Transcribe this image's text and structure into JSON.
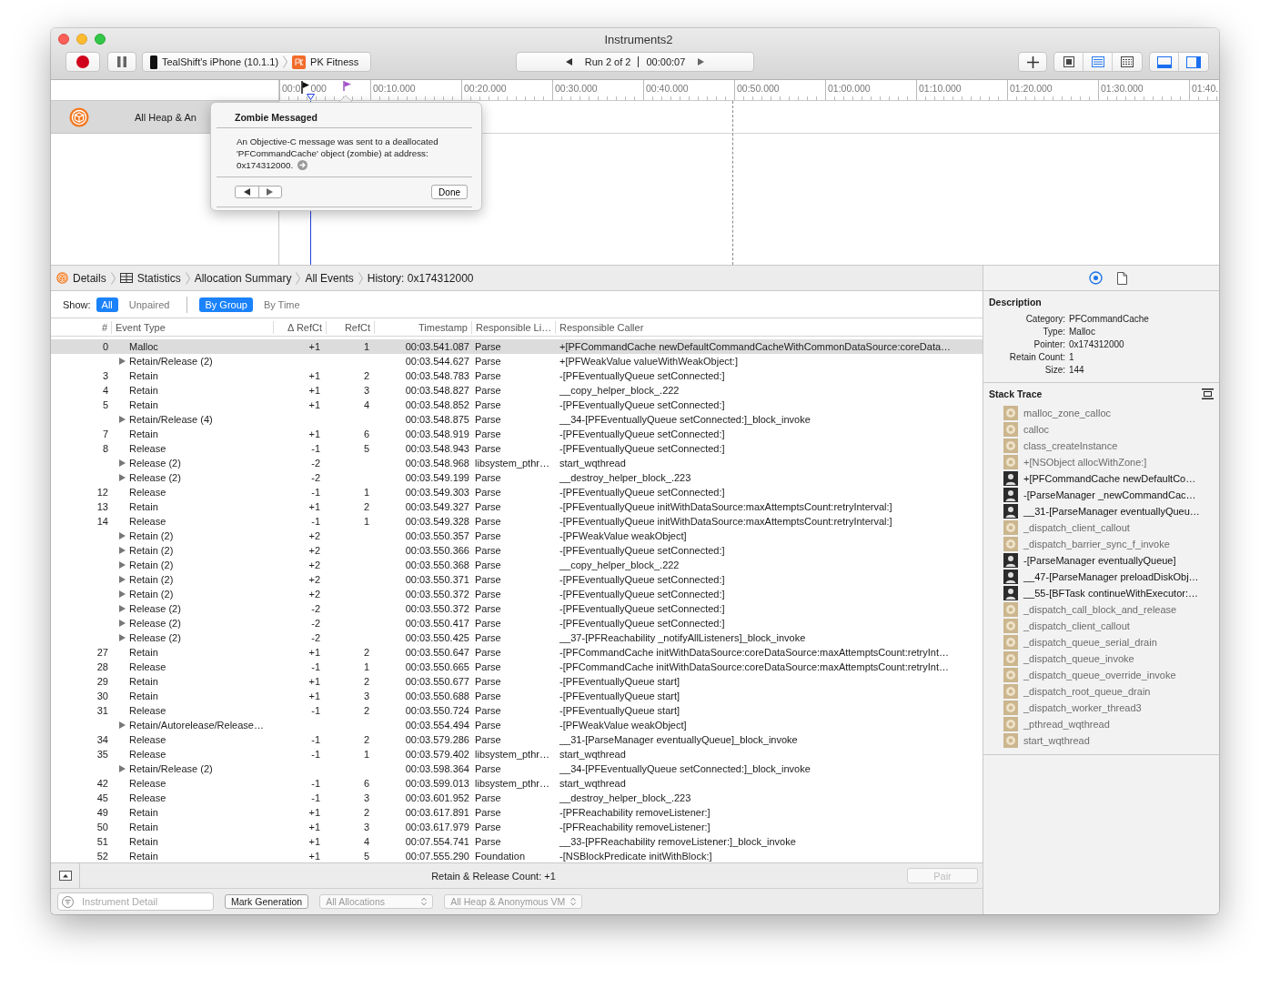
{
  "window": {
    "title": "Instruments2"
  },
  "toolbar": {
    "device": "TealShift's iPhone (10.1.1)",
    "app": "PK Fitness",
    "run": "Run 2 of 2",
    "time": "00:00:07",
    "view_buttons": [
      {
        "selected": false
      },
      {
        "selected": true
      },
      {
        "selected": false
      }
    ],
    "panels": [
      {
        "on": true
      },
      {
        "on": true
      }
    ]
  },
  "timeline": {
    "first_tick_rest": "000",
    "ticks": [
      "00:0",
      "00:10.000",
      "00:20.000",
      "00:30.000",
      "00:40.000",
      "00:50.000",
      "01:00.000",
      "01:10.000",
      "01:20.000",
      "01:30.000",
      "01:40."
    ],
    "track_label": "All Heap & An"
  },
  "popover": {
    "title": "Zombie Messaged",
    "message": "An Objective-C message was sent to a deallocated 'PFCommandCache' object (zombie) at address:",
    "address": "0x174312000.",
    "done_label": "Done"
  },
  "breadcrumbs": [
    "Details",
    "Statistics",
    "Allocation Summary",
    "All Events",
    "History: 0x174312000"
  ],
  "show_filter": {
    "label": "Show:",
    "options": [
      {
        "label": "All",
        "selected": true
      },
      {
        "label": "Unpaired",
        "selected": false
      }
    ],
    "grouping": [
      {
        "label": "By Group",
        "selected": true
      },
      {
        "label": "By Time",
        "selected": false
      }
    ]
  },
  "table": {
    "columns": [
      "#",
      "Event Type",
      "Δ RefCt",
      "RefCt",
      "Timestamp",
      "Responsible Li…",
      "Responsible Caller"
    ],
    "rows": [
      {
        "kind": "event",
        "selected": true,
        "number": "0",
        "event_type": "Malloc",
        "delta": "+1",
        "refct": "1",
        "timestamp": "00:03.541.087",
        "library": "Parse",
        "caller": "+[PFCommandCache newDefaultCommandCacheWithCommonDataSource:coreData…"
      },
      {
        "kind": "group",
        "selected": false,
        "event_type": "Retain/Release (2)",
        "timestamp": "00:03.544.627",
        "library": "Parse",
        "caller": "+[PFWeakValue valueWithWeakObject:]"
      },
      {
        "kind": "event",
        "selected": false,
        "number": "3",
        "event_type": "Retain",
        "delta": "+1",
        "refct": "2",
        "timestamp": "00:03.548.783",
        "library": "Parse",
        "caller": "-[PFEventuallyQueue setConnected:]"
      },
      {
        "kind": "event",
        "selected": false,
        "number": "4",
        "event_type": "Retain",
        "delta": "+1",
        "refct": "3",
        "timestamp": "00:03.548.827",
        "library": "Parse",
        "caller": "__copy_helper_block_.222"
      },
      {
        "kind": "event",
        "selected": false,
        "number": "5",
        "event_type": "Retain",
        "delta": "+1",
        "refct": "4",
        "timestamp": "00:03.548.852",
        "library": "Parse",
        "caller": "-[PFEventuallyQueue setConnected:]"
      },
      {
        "kind": "group",
        "selected": false,
        "event_type": "Retain/Release (4)",
        "timestamp": "00:03.548.875",
        "library": "Parse",
        "caller": "__34-[PFEventuallyQueue setConnected:]_block_invoke"
      },
      {
        "kind": "event",
        "selected": false,
        "number": "7",
        "event_type": "Retain",
        "delta": "+1",
        "refct": "6",
        "timestamp": "00:03.548.919",
        "library": "Parse",
        "caller": "-[PFEventuallyQueue setConnected:]"
      },
      {
        "kind": "event",
        "selected": false,
        "number": "8",
        "event_type": "Release",
        "delta": "-1",
        "refct": "5",
        "timestamp": "00:03.548.943",
        "library": "Parse",
        "caller": "-[PFEventuallyQueue setConnected:]"
      },
      {
        "kind": "group",
        "selected": false,
        "event_type": "Release (2)",
        "delta": "-2",
        "timestamp": "00:03.548.968",
        "library": "libsystem_pthr…",
        "caller": "start_wqthread"
      },
      {
        "kind": "group",
        "selected": false,
        "event_type": "Release (2)",
        "delta": "-2",
        "timestamp": "00:03.549.199",
        "library": "Parse",
        "caller": "__destroy_helper_block_.223"
      },
      {
        "kind": "event",
        "selected": false,
        "number": "12",
        "event_type": "Release",
        "delta": "-1",
        "refct": "1",
        "timestamp": "00:03.549.303",
        "library": "Parse",
        "caller": "-[PFEventuallyQueue setConnected:]"
      },
      {
        "kind": "event",
        "selected": false,
        "number": "13",
        "event_type": "Retain",
        "delta": "+1",
        "refct": "2",
        "timestamp": "00:03.549.327",
        "library": "Parse",
        "caller": "-[PFEventuallyQueue initWithDataSource:maxAttemptsCount:retryInterval:]"
      },
      {
        "kind": "event",
        "selected": false,
        "number": "14",
        "event_type": "Release",
        "delta": "-1",
        "refct": "1",
        "timestamp": "00:03.549.328",
        "library": "Parse",
        "caller": "-[PFEventuallyQueue initWithDataSource:maxAttemptsCount:retryInterval:]"
      },
      {
        "kind": "group",
        "selected": false,
        "event_type": "Retain (2)",
        "delta": "+2",
        "timestamp": "00:03.550.357",
        "library": "Parse",
        "caller": "-[PFWeakValue weakObject]"
      },
      {
        "kind": "group",
        "selected": false,
        "event_type": "Retain (2)",
        "delta": "+2",
        "timestamp": "00:03.550.366",
        "library": "Parse",
        "caller": "-[PFEventuallyQueue setConnected:]"
      },
      {
        "kind": "group",
        "selected": false,
        "event_type": "Retain (2)",
        "delta": "+2",
        "timestamp": "00:03.550.368",
        "library": "Parse",
        "caller": "__copy_helper_block_.222"
      },
      {
        "kind": "group",
        "selected": false,
        "event_type": "Retain (2)",
        "delta": "+2",
        "timestamp": "00:03.550.371",
        "library": "Parse",
        "caller": "-[PFEventuallyQueue setConnected:]"
      },
      {
        "kind": "group",
        "selected": false,
        "event_type": "Retain (2)",
        "delta": "+2",
        "timestamp": "00:03.550.372",
        "library": "Parse",
        "caller": "-[PFEventuallyQueue setConnected:]"
      },
      {
        "kind": "group",
        "selected": false,
        "event_type": "Release (2)",
        "delta": "-2",
        "timestamp": "00:03.550.372",
        "library": "Parse",
        "caller": "-[PFEventuallyQueue setConnected:]"
      },
      {
        "kind": "group",
        "selected": false,
        "event_type": "Release (2)",
        "delta": "-2",
        "timestamp": "00:03.550.417",
        "library": "Parse",
        "caller": "-[PFEventuallyQueue setConnected:]"
      },
      {
        "kind": "group",
        "selected": false,
        "event_type": "Release (2)",
        "delta": "-2",
        "timestamp": "00:03.550.425",
        "library": "Parse",
        "caller": "__37-[PFReachability _notifyAllListeners]_block_invoke"
      },
      {
        "kind": "event",
        "selected": false,
        "number": "27",
        "event_type": "Retain",
        "delta": "+1",
        "refct": "2",
        "timestamp": "00:03.550.647",
        "library": "Parse",
        "caller": "-[PFCommandCache initWithDataSource:coreDataSource:maxAttemptsCount:retryInt…"
      },
      {
        "kind": "event",
        "selected": false,
        "number": "28",
        "event_type": "Release",
        "delta": "-1",
        "refct": "1",
        "timestamp": "00:03.550.665",
        "library": "Parse",
        "caller": "-[PFCommandCache initWithDataSource:coreDataSource:maxAttemptsCount:retryInt…"
      },
      {
        "kind": "event",
        "selected": false,
        "number": "29",
        "event_type": "Retain",
        "delta": "+1",
        "refct": "2",
        "timestamp": "00:03.550.677",
        "library": "Parse",
        "caller": "-[PFEventuallyQueue start]"
      },
      {
        "kind": "event",
        "selected": false,
        "number": "30",
        "event_type": "Retain",
        "delta": "+1",
        "refct": "3",
        "timestamp": "00:03.550.688",
        "library": "Parse",
        "caller": "-[PFEventuallyQueue start]"
      },
      {
        "kind": "event",
        "selected": false,
        "number": "31",
        "event_type": "Release",
        "delta": "-1",
        "refct": "2",
        "timestamp": "00:03.550.724",
        "library": "Parse",
        "caller": "-[PFEventuallyQueue start]"
      },
      {
        "kind": "group",
        "selected": false,
        "event_type": "Retain/Autorelease/Release…",
        "timestamp": "00:03.554.494",
        "library": "Parse",
        "caller": "-[PFWeakValue weakObject]"
      },
      {
        "kind": "event",
        "selected": false,
        "number": "34",
        "event_type": "Release",
        "delta": "-1",
        "refct": "2",
        "timestamp": "00:03.579.286",
        "library": "Parse",
        "caller": "__31-[ParseManager eventuallyQueue]_block_invoke"
      },
      {
        "kind": "event",
        "selected": false,
        "number": "35",
        "event_type": "Release",
        "delta": "-1",
        "refct": "1",
        "timestamp": "00:03.579.402",
        "library": "libsystem_pthr…",
        "caller": "start_wqthread"
      },
      {
        "kind": "group",
        "selected": false,
        "event_type": "Retain/Release (2)",
        "timestamp": "00:03.598.364",
        "library": "Parse",
        "caller": "__34-[PFEventuallyQueue setConnected:]_block_invoke"
      },
      {
        "kind": "event",
        "selected": false,
        "number": "42",
        "event_type": "Release",
        "delta": "-1",
        "refct": "6",
        "timestamp": "00:03.599.013",
        "library": "libsystem_pthr…",
        "caller": "start_wqthread"
      },
      {
        "kind": "event",
        "selected": false,
        "number": "45",
        "event_type": "Release",
        "delta": "-1",
        "refct": "3",
        "timestamp": "00:03.601.952",
        "library": "Parse",
        "caller": "__destroy_helper_block_.223"
      },
      {
        "kind": "event",
        "selected": false,
        "number": "49",
        "event_type": "Retain",
        "delta": "+1",
        "refct": "2",
        "timestamp": "00:03.617.891",
        "library": "Parse",
        "caller": "-[PFReachability removeListener:]"
      },
      {
        "kind": "event",
        "selected": false,
        "number": "50",
        "event_type": "Retain",
        "delta": "+1",
        "refct": "3",
        "timestamp": "00:03.617.979",
        "library": "Parse",
        "caller": "-[PFReachability removeListener:]"
      },
      {
        "kind": "event",
        "selected": false,
        "number": "51",
        "event_type": "Retain",
        "delta": "+1",
        "refct": "4",
        "timestamp": "00:07.554.741",
        "library": "Parse",
        "caller": "__33-[PFReachability removeListener:]_block_invoke"
      },
      {
        "kind": "event",
        "selected": false,
        "number": "52",
        "event_type": "Retain",
        "delta": "+1",
        "refct": "5",
        "timestamp": "00:07.555.290",
        "library": "Foundation",
        "caller": "-[NSBlockPredicate initWithBlock:]"
      }
    ]
  },
  "status_bar": {
    "text": "Retain & Release Count: +1",
    "pair_button": {
      "label": "Pair",
      "disabled": true
    }
  },
  "filter_bar": {
    "placeholder": "Instrument Detail",
    "controls": [
      {
        "kind": "button",
        "label": "Mark Generation",
        "disabled": false
      },
      {
        "kind": "popup",
        "label": "All Allocations",
        "disabled": true
      },
      {
        "kind": "popup",
        "label": "All Heap & Anonymous VM",
        "disabled": true
      }
    ]
  },
  "inspector": {
    "description": {
      "title": "Description",
      "fields": [
        {
          "label": "Category:",
          "value": "PFCommandCache"
        },
        {
          "label": "Type:",
          "value": "Malloc"
        },
        {
          "label": "Pointer:",
          "value": "0x174312000"
        },
        {
          "label": "Retain Count:",
          "value": "1"
        },
        {
          "label": "Size:",
          "value": "144"
        }
      ]
    },
    "stack_trace": {
      "title": "Stack Trace",
      "frames": [
        {
          "kind": "system",
          "label": "malloc_zone_calloc"
        },
        {
          "kind": "system",
          "label": "calloc"
        },
        {
          "kind": "system",
          "label": "class_createInstance"
        },
        {
          "kind": "system",
          "label": "+[NSObject allocWithZone:]"
        },
        {
          "kind": "user",
          "label": "+[PFCommandCache newDefaultCo…"
        },
        {
          "kind": "user",
          "label": "-[ParseManager _newCommandCac…"
        },
        {
          "kind": "user",
          "label": "__31-[ParseManager eventuallyQueu…"
        },
        {
          "kind": "system",
          "label": "_dispatch_client_callout"
        },
        {
          "kind": "system",
          "label": "_dispatch_barrier_sync_f_invoke"
        },
        {
          "kind": "user",
          "label": "-[ParseManager eventuallyQueue]"
        },
        {
          "kind": "user",
          "label": "__47-[ParseManager preloadDiskObj…"
        },
        {
          "kind": "user",
          "label": "__55-[BFTask continueWithExecutor:…"
        },
        {
          "kind": "system",
          "label": "_dispatch_call_block_and_release"
        },
        {
          "kind": "system",
          "label": "_dispatch_client_callout"
        },
        {
          "kind": "system",
          "label": "_dispatch_queue_serial_drain"
        },
        {
          "kind": "system",
          "label": "_dispatch_queue_invoke"
        },
        {
          "kind": "system",
          "label": "_dispatch_queue_override_invoke"
        },
        {
          "kind": "system",
          "label": "_dispatch_root_queue_drain"
        },
        {
          "kind": "system",
          "label": "_dispatch_worker_thread3"
        },
        {
          "kind": "system",
          "label": "_pthread_wqthread"
        },
        {
          "kind": "system",
          "label": "start_wqthread"
        }
      ]
    }
  }
}
